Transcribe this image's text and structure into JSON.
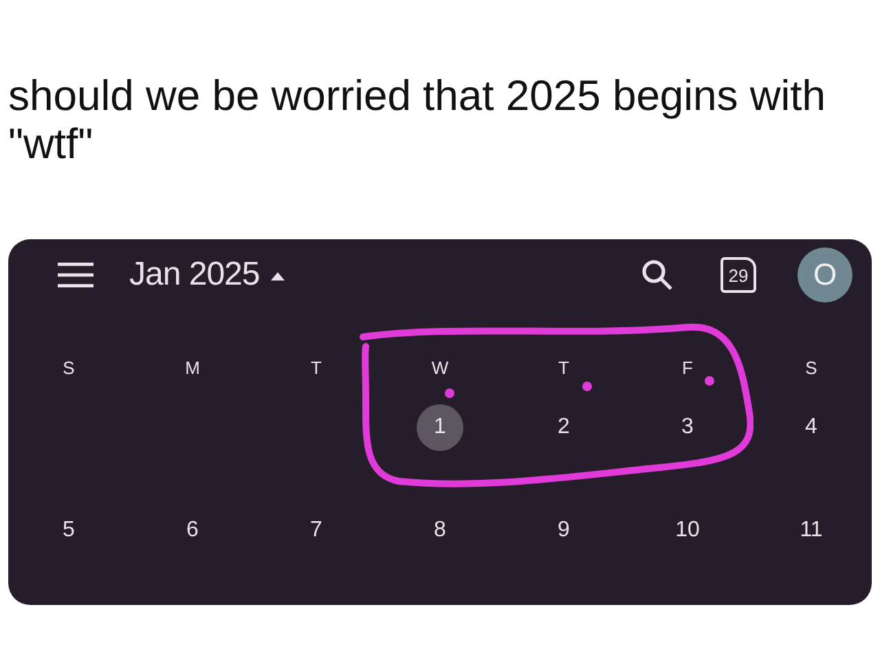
{
  "post": {
    "text": "should we be worried that 2025 begins with \"wtf\""
  },
  "calendar": {
    "title": "Jan 2025",
    "today_badge": "29",
    "avatar_letter": "O",
    "weekdays": [
      "S",
      "M",
      "T",
      "W",
      "T",
      "F",
      "S"
    ],
    "weeks": [
      {
        "kind": "first",
        "days": [
          {
            "label": "1",
            "selected": true
          },
          {
            "label": "2",
            "selected": false
          },
          {
            "label": "3",
            "selected": false
          },
          {
            "label": "4",
            "selected": false
          }
        ]
      },
      {
        "kind": "full",
        "days": [
          {
            "label": "5",
            "selected": false
          },
          {
            "label": "6",
            "selected": false
          },
          {
            "label": "7",
            "selected": false
          },
          {
            "label": "8",
            "selected": false
          },
          {
            "label": "9",
            "selected": false
          },
          {
            "label": "10",
            "selected": false
          },
          {
            "label": "11",
            "selected": false
          }
        ]
      }
    ]
  }
}
